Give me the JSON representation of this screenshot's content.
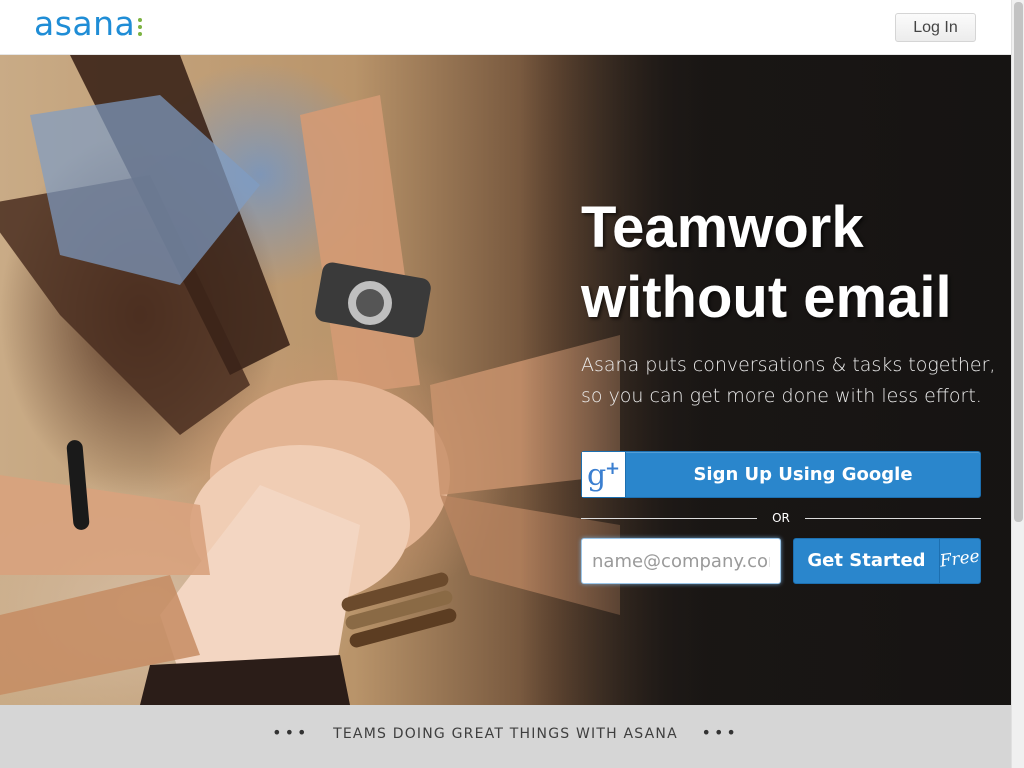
{
  "header": {
    "logo_text": "asana",
    "login_label": "Log In"
  },
  "hero": {
    "headline": "Teamwork without email",
    "subtext": "Asana puts conversations & tasks together, so you can get more done with less effort.",
    "google_button_label": "Sign Up Using Google",
    "google_icon": "google-plus-icon",
    "or_label": "OR",
    "email_placeholder": "name@company.com",
    "get_started_label": "Get Started",
    "free_badge": "Free",
    "image_description_colors": {
      "brand_blue": "#1f8dd6",
      "button_blue": "#2a86cc",
      "logo_dots_green": "#7cb342"
    }
  },
  "footer_strip": {
    "text": "TEAMS DOING GREAT THINGS WITH ASANA",
    "dots_left": "•••",
    "dots_right": "•••"
  }
}
